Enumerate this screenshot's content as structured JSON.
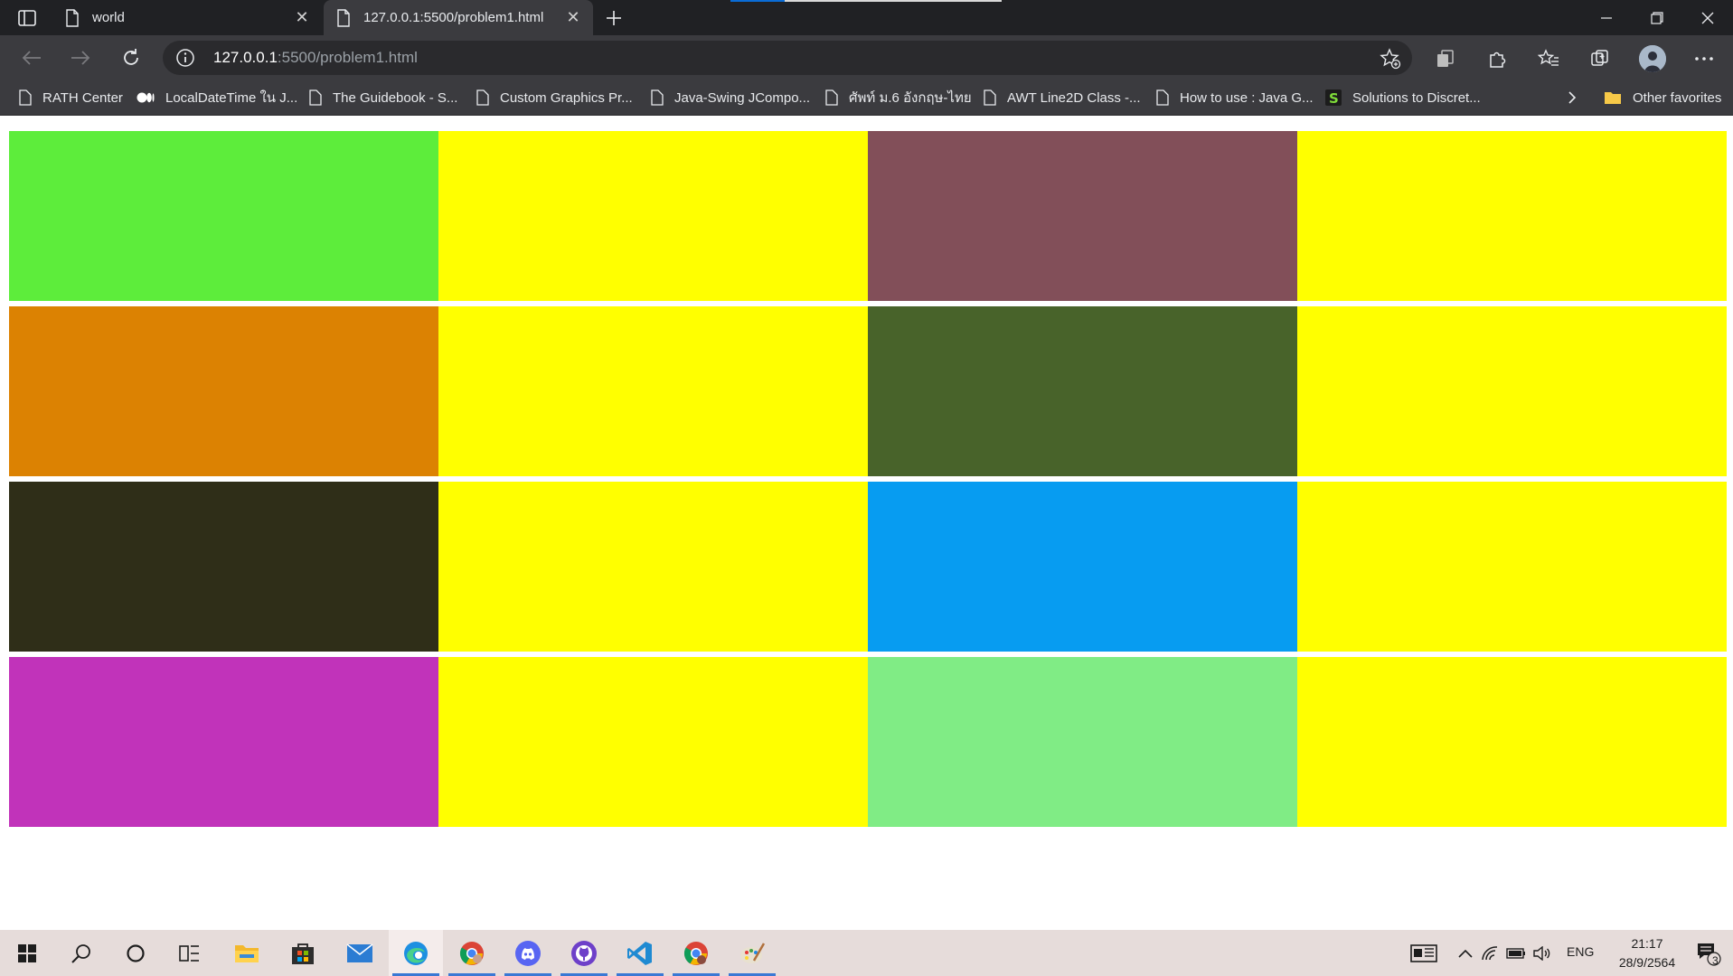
{
  "browser": {
    "tabs": [
      {
        "title": "world",
        "active": false
      },
      {
        "title": "127.0.0.1:5500/problem1.html",
        "active": true
      }
    ],
    "address": {
      "host": "127.0.0.1",
      "rest": ":5500/problem1.html"
    },
    "favorites": [
      {
        "label": "RATH Center",
        "icon": "page-icon"
      },
      {
        "label": "LocalDateTime ใน J...",
        "icon": "medium-icon"
      },
      {
        "label": "The Guidebook - S...",
        "icon": "page-icon"
      },
      {
        "label": "Custom Graphics Pr...",
        "icon": "page-icon"
      },
      {
        "label": "Java-Swing JCompo...",
        "icon": "page-icon"
      },
      {
        "label": "ศัพท์ ม.6 อังกฤษ-ไทย",
        "icon": "page-icon"
      },
      {
        "label": "AWT Line2D Class -...",
        "icon": "page-icon"
      },
      {
        "label": "How to use : Java G...",
        "icon": "page-icon"
      },
      {
        "label": "Solutions to Discret...",
        "icon": "s-icon"
      }
    ],
    "other_favorites": "Other favorites"
  },
  "page": {
    "rows": [
      [
        "#5ded3b",
        "#ffff00",
        "#824f59",
        "#ffff00"
      ],
      [
        "#dc8202",
        "#ffff00",
        "#48632a",
        "#ffff00"
      ],
      [
        "#2f2e18",
        "#ffff00",
        "#079cf1",
        "#ffff00"
      ],
      [
        "#c133ba",
        "#ffff00",
        "#80ec85",
        "#ffff00"
      ]
    ]
  },
  "taskbar": {
    "language": "ENG",
    "time": "21:17",
    "date": "28/9/2564",
    "notification_count": "3"
  }
}
